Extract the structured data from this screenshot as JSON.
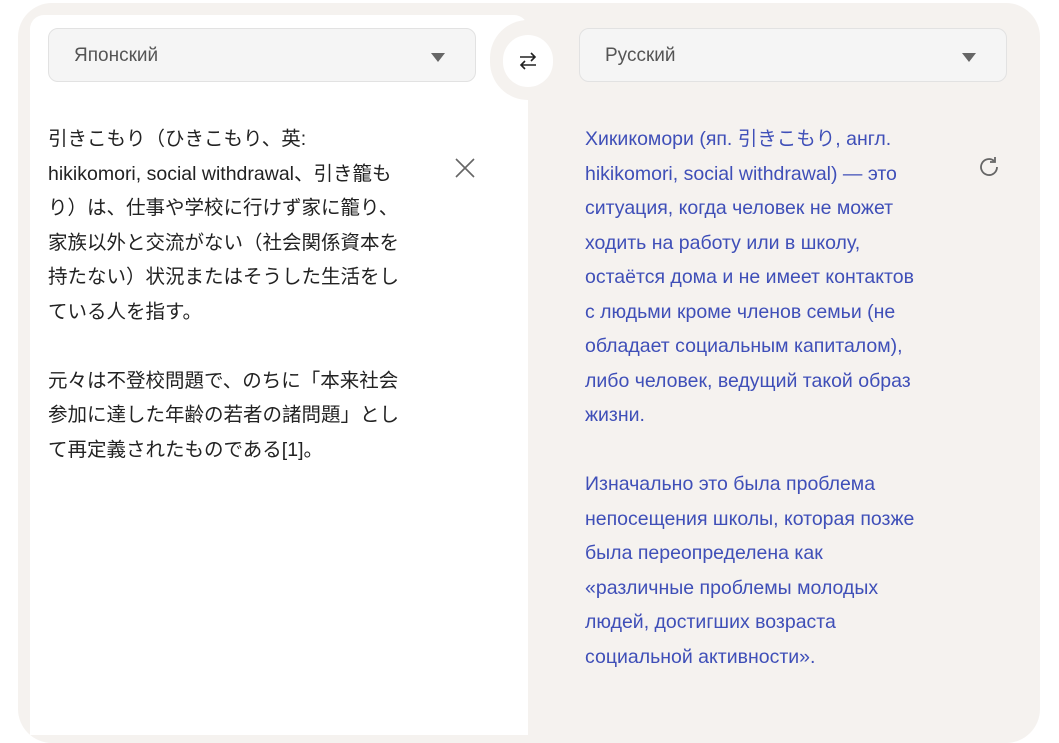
{
  "source_language": "Японский",
  "target_language": "Русский",
  "source_text": {
    "paragraphs": [
      [
        "引きこもり（ひきこもり、英:",
        "hikikomori, social withdrawal、引き籠も",
        "り）は、仕事や学校に行けず家に籠り、",
        "家族以外と交流がない（社会関係資本を",
        "持たない）状況またはそうした生活をし",
        "ている人を指す。"
      ],
      [
        "元々は不登校問題で、のちに「本来社会",
        "参加に達した年齢の若者の諸問題」とし",
        "て再定義されたものである[1]。"
      ]
    ]
  },
  "translated_text": {
    "paragraphs": [
      [
        "Хикикомори (яп. 引きこもり, англ.",
        "hikikomori, social withdrawal) — это",
        "ситуация, когда человек не может",
        "ходить на работу или в школу,",
        "остаётся дома и не имеет контактов",
        "с людьми кроме членов семьи (не",
        "обладает социальным капиталом),",
        "либо человек, ведущий такой образ",
        "жизни."
      ],
      [
        "Изначально это была проблема",
        "непосещения школы, которая позже",
        "была переопределена как",
        "«различные проблемы молодых",
        "людей, достигших возраста",
        "социальной активности»."
      ]
    ]
  },
  "icons": {
    "swap": "swap-arrows-icon",
    "clear": "close-icon",
    "retranslate": "refresh-icon"
  },
  "colors": {
    "translation_text": "#3f4fb8",
    "panel_bg": "#f5f2ef"
  }
}
